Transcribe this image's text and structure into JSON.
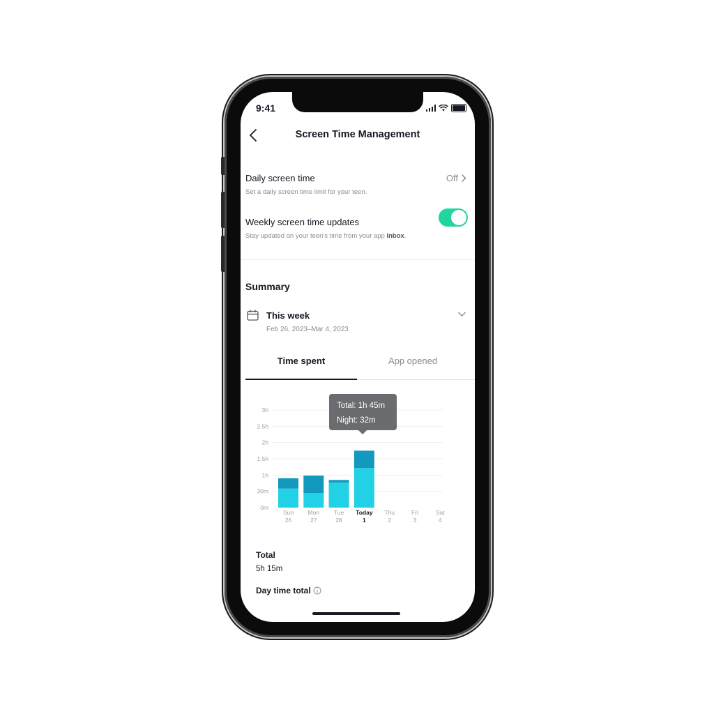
{
  "status_bar": {
    "time": "9:41"
  },
  "header": {
    "title": "Screen Time Management",
    "back_icon": "chevron-left-icon"
  },
  "settings": {
    "daily": {
      "title": "Daily screen time",
      "subtitle": "Set a daily screen time limit for your teen.",
      "value": "Off"
    },
    "weekly": {
      "title": "Weekly screen time updates",
      "subtitle": "Stay updated on your teen's time from your app ",
      "subtitle_bold": "Inbox",
      "subtitle_end": ".",
      "enabled": true
    }
  },
  "summary": {
    "heading": "Summary",
    "period_label": "This week",
    "period_range": "Feb 26, 2023–Mar 4, 2023",
    "tabs": [
      {
        "label": "Time spent",
        "active": true
      },
      {
        "label": "App opened",
        "active": false
      }
    ]
  },
  "tooltip": {
    "total": "Total: 1h 45m",
    "night": "Night: 32m"
  },
  "colors": {
    "day": "#22d1e6",
    "night": "#1399bd",
    "toggle": "#20d5a0"
  },
  "chart_data": {
    "type": "bar",
    "stacked": true,
    "categories": [
      "Sun 26",
      "Mon 27",
      "Tue 28",
      "Today 1",
      "Thu 2",
      "Fri 3",
      "Sat 4"
    ],
    "day_labels": [
      "Sun",
      "Mon",
      "Tue",
      "Today",
      "Thu",
      "Fri",
      "Sat"
    ],
    "date_labels": [
      "26",
      "27",
      "28",
      "1",
      "2",
      "3",
      "4"
    ],
    "highlight_index": 3,
    "series": [
      {
        "name": "Day",
        "values": [
          35,
          27,
          46,
          73,
          0,
          0,
          0
        ]
      },
      {
        "name": "Night",
        "values": [
          19,
          32,
          5,
          32,
          0,
          0,
          0
        ]
      }
    ],
    "unit": "minutes",
    "yticks": [
      0,
      30,
      60,
      90,
      120,
      150,
      180
    ],
    "ytick_labels": [
      "0m",
      "30m",
      "1h",
      "1.5h",
      "2h",
      "2.5h",
      "3h"
    ],
    "ylim": [
      0,
      180
    ],
    "grid": true
  },
  "totals": {
    "total_label": "Total",
    "total_value": "5h 15m",
    "daytime_label": "Day time total"
  }
}
